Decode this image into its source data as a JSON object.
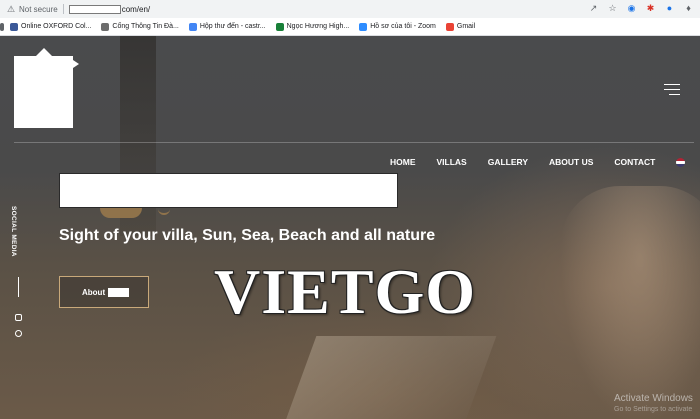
{
  "browser": {
    "security_label": "Not secure",
    "url_path": "com/en/",
    "bookmarks": [
      {
        "label": "Online OXFORD Col...",
        "color": "#3b5998"
      },
      {
        "label": "Cổng Thông Tin Đà...",
        "color": "#6d6d6d"
      },
      {
        "label": "Hộp thư đến - castr...",
        "color": "#4285f4"
      },
      {
        "label": "Ngọc Hương High...",
        "color": "#188038"
      },
      {
        "label": "Hồ sơ của tôi - Zoom",
        "color": "#2d8cff"
      },
      {
        "label": "Gmail",
        "color": "#ea4335"
      }
    ],
    "toolbar_icons": [
      "share-icon",
      "star-icon",
      "translate-icon",
      "extension-icon",
      "puzzle-icon"
    ]
  },
  "header": {
    "nav": [
      "HOME",
      "VILLAS",
      "GALLERY",
      "ABOUT US",
      "CONTACT"
    ],
    "language": "us-flag-icon"
  },
  "sidebar": {
    "social_label": "SOCIAL MEDIA"
  },
  "hero": {
    "subtitle": "Sight of your villa, Sun, Sea, Beach and all nature",
    "about_label": "About"
  },
  "watermark": "VIETGO",
  "windows": {
    "activate_title": "Activate Windows",
    "activate_sub": "Go to Settings to activate"
  },
  "colors": {
    "accent_gold": "#c9a97a",
    "hero_dark": "#4a4b4d"
  }
}
